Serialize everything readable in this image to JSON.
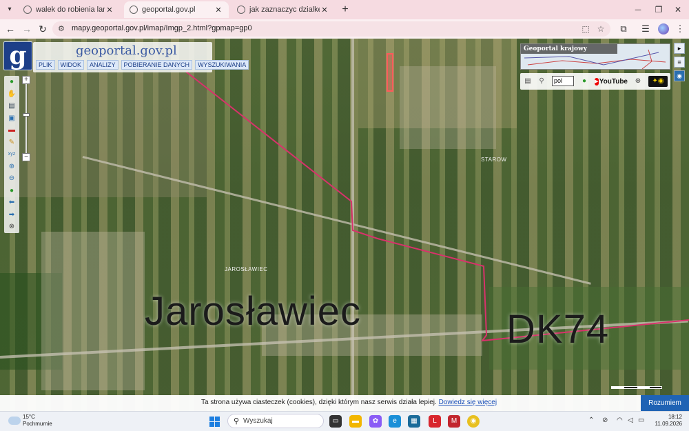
{
  "browser": {
    "tabs": [
      {
        "title": "walek do robienia lamperii - Sz"
      },
      {
        "title": "geoportal.gov.pl"
      },
      {
        "title": "jak zaznaczyc dzialke na geop"
      }
    ],
    "url": "mapy.geoportal.gov.pl/imap/Imgp_2.html?gpmap=gp0"
  },
  "geoportal": {
    "logo_letter": "g",
    "title": "geoportal.gov.pl",
    "menu": [
      "PLIK",
      "WIDOK",
      "ANALIZY",
      "POBIERANIE DANYCH",
      "WYSZUKIWANIA"
    ],
    "overview_title": "Geoportal krajowy",
    "language": "pol",
    "youtube_label": "YouTube"
  },
  "map": {
    "big_labels": {
      "village": "Jarosławiec",
      "road": "DK74"
    },
    "small_labels": {
      "village": "JAROSŁAWIEC",
      "north_village": "STAROW"
    }
  },
  "cookie": {
    "message": "Ta strona używa ciasteczek (cookies), dzięki którym nasz serwis działa lepiej.",
    "link": "Dowiedz się więcej",
    "accept": "Rozumiem"
  },
  "taskbar": {
    "temperature": "15°C",
    "weather": "Pochmurnie",
    "search_placeholder": "Wyszukaj",
    "time": "18:12",
    "date": "11.09.2026"
  },
  "colors": {
    "boundary": "#d8326b",
    "accent": "#1d3f88",
    "taskbar_search": "#ffffff"
  }
}
